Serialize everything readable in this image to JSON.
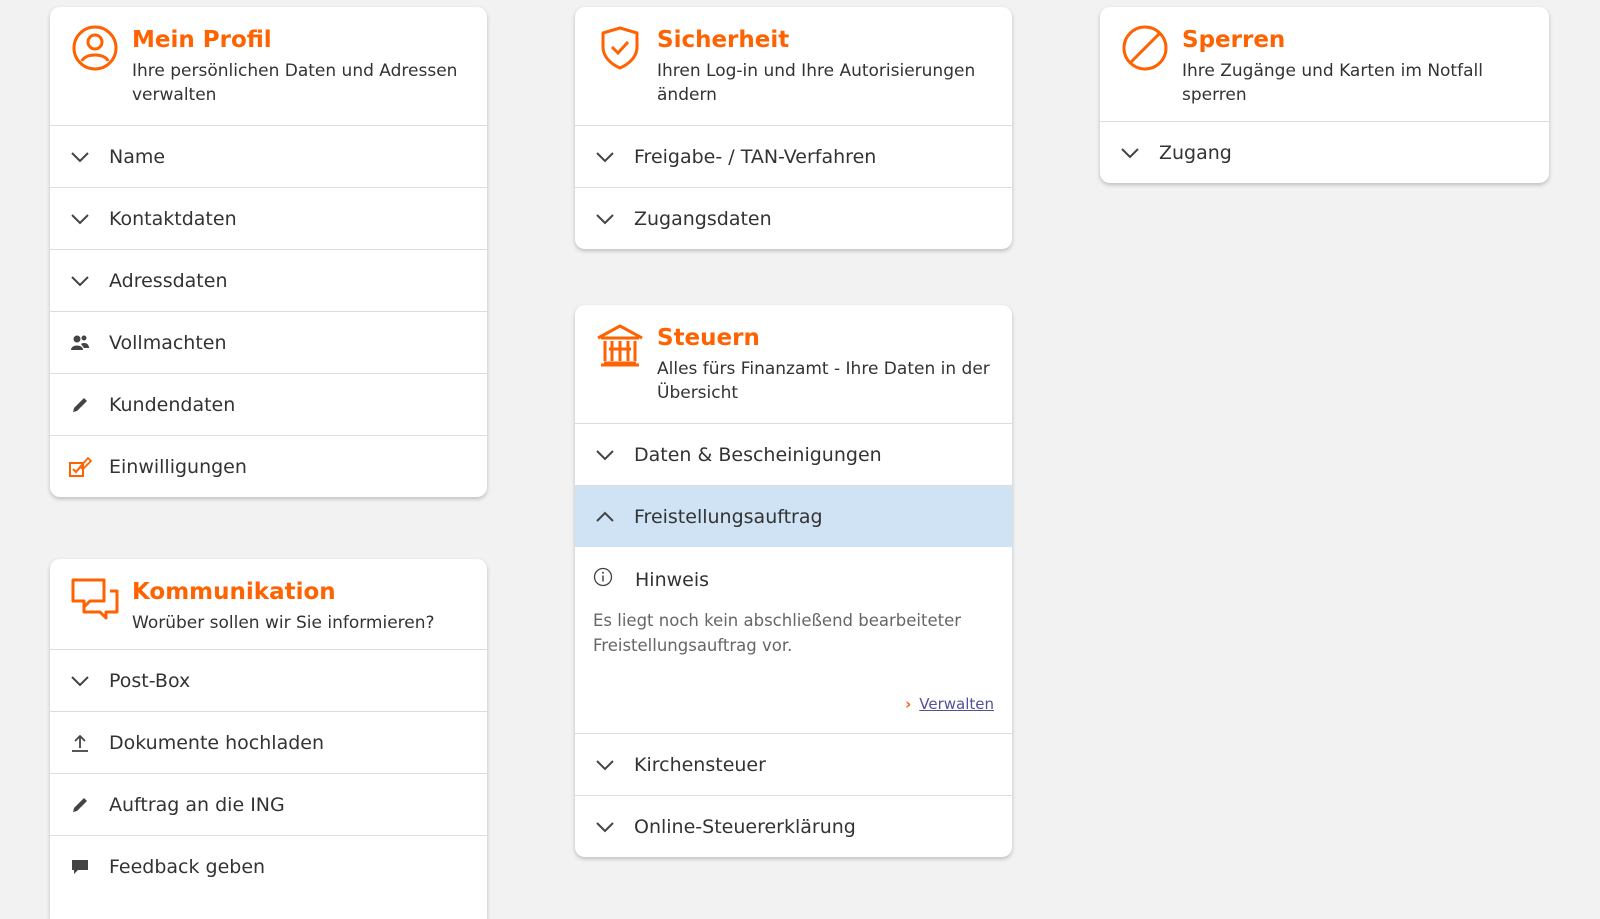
{
  "profil": {
    "title": "Mein Profil",
    "subtitle": "Ihre persönlichen Daten und Adressen verwalten",
    "icon": "user-circle-icon",
    "items": [
      {
        "label": "Name",
        "icon": "chevron-down-icon"
      },
      {
        "label": "Kontaktdaten",
        "icon": "chevron-down-icon"
      },
      {
        "label": "Adressdaten",
        "icon": "chevron-down-icon"
      },
      {
        "label": "Vollmachten",
        "icon": "people-icon"
      },
      {
        "label": "Kundendaten",
        "icon": "pencil-icon"
      },
      {
        "label": "Einwilligungen",
        "icon": "edit-checkbox-icon"
      }
    ]
  },
  "kommunikation": {
    "title": "Kommunikation",
    "subtitle": "Worüber sollen wir Sie informieren?",
    "icon": "chat-bubbles-icon",
    "items": [
      {
        "label": "Post-Box",
        "icon": "chevron-down-icon"
      },
      {
        "label": "Dokumente hochladen",
        "icon": "upload-icon"
      },
      {
        "label": "Auftrag an die ING",
        "icon": "pencil-icon"
      },
      {
        "label": "Feedback geben",
        "icon": "speech-bubble-icon"
      }
    ]
  },
  "sicherheit": {
    "title": "Sicherheit",
    "subtitle": "Ihren Log-in und Ihre Autorisierungen ändern",
    "icon": "shield-check-icon",
    "items": [
      {
        "label": "Freigabe- / TAN-Verfahren",
        "icon": "chevron-down-icon"
      },
      {
        "label": "Zugangsdaten",
        "icon": "chevron-down-icon"
      }
    ]
  },
  "steuern": {
    "title": "Steuern",
    "subtitle": "Alles fürs Finanzamt - Ihre Daten in der Übersicht",
    "icon": "building-icon",
    "items": [
      {
        "label": "Daten & Bescheinigungen",
        "icon": "chevron-down-icon"
      },
      {
        "label": "Freistellungsauftrag",
        "icon": "chevron-up-icon",
        "active": true
      },
      {
        "label": "Kirchensteuer",
        "icon": "chevron-down-icon"
      },
      {
        "label": "Online-Steuererklärung",
        "icon": "chevron-down-icon"
      }
    ],
    "expanded": {
      "hinweis_label": "Hinweis",
      "hinweis_text": "Es liegt noch kein abschließend bearbeiteter Freistellungsauftrag vor.",
      "link_label": "Verwalten",
      "link_chevron": "›"
    }
  },
  "sperren": {
    "title": "Sperren",
    "subtitle": "Ihre Zugänge und Karten im Notfall sperren",
    "icon": "block-icon",
    "items": [
      {
        "label": "Zugang",
        "icon": "chevron-down-icon"
      }
    ]
  },
  "colors": {
    "accent": "#ff6200",
    "active_row": "#cfe3f5",
    "link": "#525199",
    "background": "#f2f2f2"
  }
}
